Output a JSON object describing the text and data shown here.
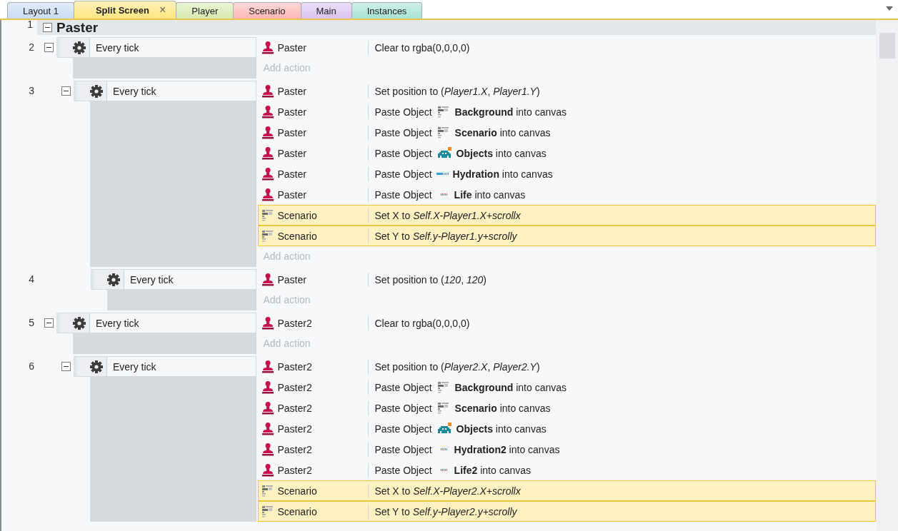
{
  "tabs": [
    {
      "label": "Layout 1",
      "selected": false,
      "color": "#c9dcf3"
    },
    {
      "label": "Split Screen",
      "selected": true,
      "color": "#ffe680",
      "close": "×"
    },
    {
      "label": "Player",
      "selected": false,
      "color": "#d6ebb0"
    },
    {
      "label": "Scenario",
      "selected": false,
      "color": "#ffb6b6"
    },
    {
      "label": "Main",
      "selected": false,
      "color": "#d9c2f0"
    },
    {
      "label": "Instances",
      "selected": false,
      "color": "#a6e2d4"
    }
  ],
  "group": {
    "number": "1",
    "title": "Paster",
    "expanded": true
  },
  "events": [
    {
      "number": "2",
      "expanded": true,
      "condition": "Every tick",
      "actions": [
        {
          "object": {
            "kind": "paster",
            "name": "Paster"
          },
          "selected": false,
          "text": "Clear to rgba(0,0,0,0)"
        }
      ],
      "add_action": "Add action",
      "children": [
        {
          "number": "3",
          "expanded": true,
          "condition": "Every tick",
          "actions": [
            {
              "object": {
                "kind": "paster",
                "name": "Paster"
              },
              "selected": false,
              "text": "Set position to (*Player1.X*, *Player1.Y*)"
            },
            {
              "object": {
                "kind": "paster",
                "name": "Paster"
              },
              "selected": false,
              "text": "Paste Object",
              "param": {
                "kind": "sprite",
                "text": "**Background** into canvas"
              }
            },
            {
              "object": {
                "kind": "paster",
                "name": "Paster"
              },
              "selected": false,
              "text": "Paste Object",
              "param": {
                "kind": "sprite",
                "text": "**Scenario** into canvas"
              }
            },
            {
              "object": {
                "kind": "paster",
                "name": "Paster"
              },
              "selected": false,
              "text": "Paste Object",
              "param": {
                "kind": "invader",
                "text": "**Objects** into canvas"
              }
            },
            {
              "object": {
                "kind": "paster",
                "name": "Paster"
              },
              "selected": false,
              "text": "Paste Object",
              "param": {
                "kind": "bar",
                "color": "#2a9fe0",
                "text": "**Hydration** into canvas"
              }
            },
            {
              "object": {
                "kind": "paster",
                "name": "Paster"
              },
              "selected": false,
              "text": "Paste Object",
              "param": {
                "kind": "dots",
                "color": "#e0506a",
                "text": "**Life** into canvas"
              }
            },
            {
              "object": {
                "kind": "sprite",
                "name": "Scenario"
              },
              "selected": true,
              "text": "Set X to *Self.X-Player1.X+scrollx*"
            },
            {
              "object": {
                "kind": "sprite",
                "name": "Scenario"
              },
              "selected": true,
              "text": "Set Y to *Self.y-Player1.y+scrolly*"
            }
          ],
          "add_action": "Add action",
          "children": [
            {
              "number": "4",
              "condition": "Every tick",
              "actions": [
                {
                  "object": {
                    "kind": "paster",
                    "name": "Paster"
                  },
                  "selected": false,
                  "text": "Set position to (*120*, *120*)"
                }
              ],
              "add_action": "Add action"
            }
          ]
        }
      ]
    },
    {
      "number": "5",
      "expanded": true,
      "condition": "Every tick",
      "actions": [
        {
          "object": {
            "kind": "paster",
            "name": "Paster2"
          },
          "selected": false,
          "text": "Clear to rgba(0,0,0,0)"
        }
      ],
      "add_action": "Add action",
      "children": [
        {
          "number": "6",
          "expanded": true,
          "condition": "Every tick",
          "actions": [
            {
              "object": {
                "kind": "paster",
                "name": "Paster2"
              },
              "selected": false,
              "text": "Set position to (*Player2.X*, *Player2.Y*)"
            },
            {
              "object": {
                "kind": "paster",
                "name": "Paster2"
              },
              "selected": false,
              "text": "Paste Object",
              "param": {
                "kind": "sprite",
                "text": "**Background** into canvas"
              }
            },
            {
              "object": {
                "kind": "paster",
                "name": "Paster2"
              },
              "selected": false,
              "text": "Paste Object",
              "param": {
                "kind": "sprite",
                "text": "**Scenario** into canvas"
              }
            },
            {
              "object": {
                "kind": "paster",
                "name": "Paster2"
              },
              "selected": false,
              "text": "Paste Object",
              "param": {
                "kind": "invader",
                "text": "**Objects** into canvas"
              }
            },
            {
              "object": {
                "kind": "paster",
                "name": "Paster2"
              },
              "selected": false,
              "text": "Paste Object",
              "param": {
                "kind": "dots",
                "color": "#2a9fe0",
                "text": "**Hydration2** into canvas"
              }
            },
            {
              "object": {
                "kind": "paster",
                "name": "Paster2"
              },
              "selected": false,
              "text": "Paste Object",
              "param": {
                "kind": "dots",
                "color": "#e0506a",
                "text": "**Life2** into canvas"
              }
            },
            {
              "object": {
                "kind": "sprite",
                "name": "Scenario"
              },
              "selected": true,
              "text": "Set X to *Self.X-Player2.X+scrollx*"
            },
            {
              "object": {
                "kind": "sprite",
                "name": "Scenario"
              },
              "selected": true,
              "text": "Set Y to *Self.y-Player2.y+scrolly*"
            }
          ]
        }
      ]
    }
  ]
}
